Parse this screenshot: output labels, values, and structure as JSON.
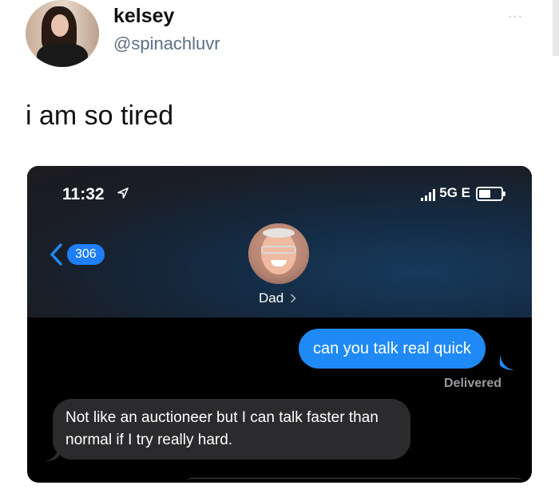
{
  "tweet": {
    "author_name": "kelsey",
    "author_handle": "@spinachluvr",
    "more_icon": "···",
    "text": "i am so tired"
  },
  "screenshot": {
    "status_bar": {
      "time": "11:32",
      "network": "5G E",
      "location_icon": "location-arrow-icon",
      "signal_icon": "cell-signal-icon",
      "battery_icon": "battery-icon"
    },
    "nav": {
      "back_count": "306",
      "contact_name": "Dad",
      "contact_chevron": "chevron-right-icon"
    },
    "messages": {
      "sent_text": "can you talk real quick",
      "sent_status": "Delivered",
      "received_text": "Not like an auctioneer but I can talk faster than normal if I try really hard."
    },
    "colors": {
      "sent_bubble": "#1f8af5",
      "received_bubble": "#2b2b2d",
      "badge": "#1f7ef6"
    }
  }
}
